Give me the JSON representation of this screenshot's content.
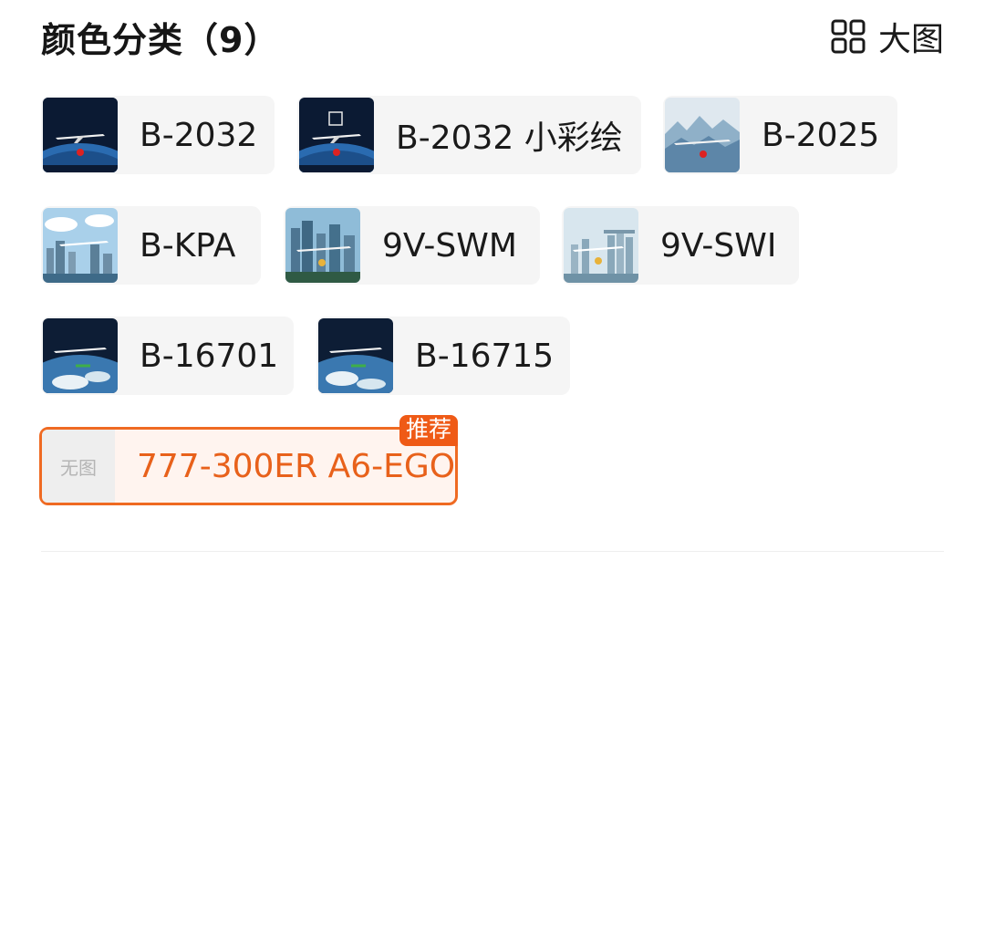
{
  "header": {
    "title": "颜色分类（9）",
    "view_label": "大图",
    "view_icon": "grid-icon"
  },
  "options": [
    {
      "label": "B-2032",
      "thumb": "night-earth"
    },
    {
      "label": "B-2032 小彩绘",
      "thumb": "night-earth-15"
    },
    {
      "label": "B-2025",
      "thumb": "mountains"
    },
    {
      "label": "B-KPA",
      "thumb": "city-day"
    },
    {
      "label": "9V-SWM",
      "thumb": "city-towers"
    },
    {
      "label": "9V-SWI",
      "thumb": "city-haze"
    },
    {
      "label": "B-16701",
      "thumb": "earth-orbit"
    },
    {
      "label": "B-16715",
      "thumb": "earth-orbit"
    },
    {
      "label": "777-300ER A6-EGO",
      "thumb": "none",
      "no_image_text": "无图",
      "badge": "推荐",
      "selected": true
    }
  ],
  "colors": {
    "accent": "#ef6a22",
    "selected_bg": "#fff4ef",
    "chip_bg": "#f5f5f5"
  }
}
